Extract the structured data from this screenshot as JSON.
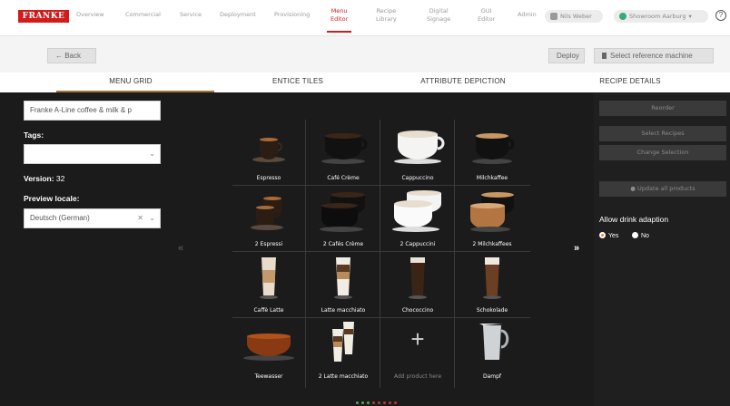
{
  "brand": {
    "logo_text": "FRANKE",
    "accent": "#d21b1b",
    "tab_accent": "#a0753c"
  },
  "nav": {
    "items": [
      {
        "label": "Overview"
      },
      {
        "label": "Commercial"
      },
      {
        "label": "Service"
      },
      {
        "label": "Deployment"
      },
      {
        "label": "Provisioning"
      },
      {
        "label": "Menu\nEditor",
        "active": true
      },
      {
        "label": "Recipe\nLibrary"
      },
      {
        "label": "Digital\nSignage"
      },
      {
        "label": "GUI\nEditor"
      },
      {
        "label": "Admin"
      }
    ],
    "user": "Nils Weber",
    "location": "Showroom Aarburg",
    "help": "?"
  },
  "actions": {
    "back": "←  Back",
    "deploy": "Deploy",
    "select_machine": "Select reference machine"
  },
  "tabs": [
    "MENU GRID",
    "ENTICE TILES",
    "ATTRIBUTE DEPICTION",
    "RECIPE DETAILS"
  ],
  "left_panel": {
    "menu_name": "Franke A-Line coffee & milk & p",
    "tags_label": "Tags:",
    "tags_value": "",
    "version_label": "Version:",
    "version_value": "32",
    "locale_label": "Preview locale:",
    "locale_value": "Deutsch (German)"
  },
  "grid": {
    "products": [
      {
        "label": "Espresso",
        "icon": "espresso-cup-icon"
      },
      {
        "label": "Café Crème",
        "icon": "black-coffee-cup-icon"
      },
      {
        "label": "Cappuccino",
        "icon": "cappuccino-cup-icon"
      },
      {
        "label": "Milchkaffee",
        "icon": "milk-coffee-cup-icon"
      },
      {
        "label": "2 Espressi",
        "icon": "double-espresso-cup-icon"
      },
      {
        "label": "2 Cafés Crème",
        "icon": "double-black-coffee-cup-icon"
      },
      {
        "label": "2 Cappuccini",
        "icon": "double-cappuccino-cup-icon"
      },
      {
        "label": "2 Milchkaffees",
        "icon": "double-milk-coffee-cup-icon"
      },
      {
        "label": "Caffè Latte",
        "icon": "latte-glass-icon"
      },
      {
        "label": "Latte macchiato",
        "icon": "latte-macchiato-glass-icon"
      },
      {
        "label": "Chococcino",
        "icon": "chococcino-glass-icon"
      },
      {
        "label": "Schokolade",
        "icon": "chocolate-glass-icon"
      },
      {
        "label": "Teewasser",
        "icon": "tea-cup-icon"
      },
      {
        "label": "2 Latte macchiato",
        "icon": "double-latte-macchiato-glass-icon"
      },
      {
        "label": "Add product here",
        "icon": "plus-icon"
      },
      {
        "label": "Dampf",
        "icon": "milk-jug-icon"
      }
    ],
    "prev": "«",
    "next": "»"
  },
  "right_panel": {
    "reorder": "Reorder",
    "select_recipes": "Select Recipes",
    "change_selection": "Change Selection",
    "update_all": "● Update all products",
    "adapt_label": "Allow drink adaption",
    "yes": "Yes",
    "no": "No"
  }
}
